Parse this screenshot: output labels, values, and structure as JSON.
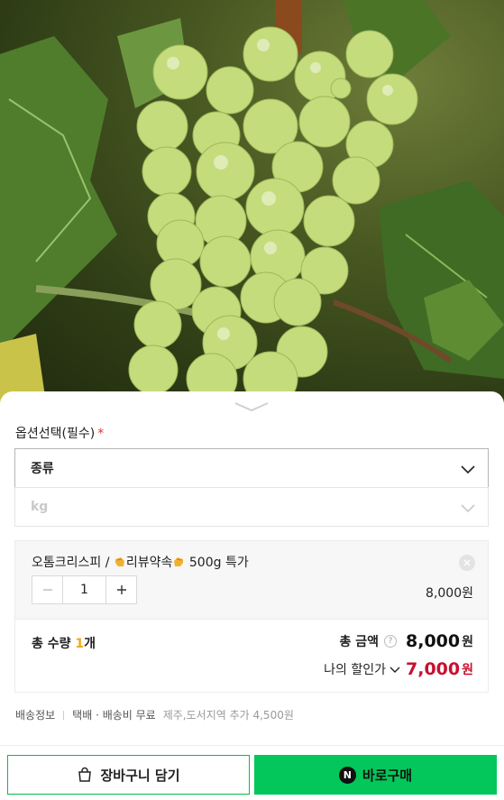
{
  "option": {
    "title": "옵션선택(필수)",
    "required_mark": "*",
    "select_type": "종류",
    "select_weight": "kg"
  },
  "item": {
    "name_prefix": "오톰크리스피 / ",
    "name_review": "리뷰약속",
    "name_suffix": " 500g 특가",
    "quantity": "1",
    "price": "8,000원"
  },
  "total": {
    "qty_label": "총 수량 ",
    "qty_value": "1",
    "qty_unit": "개",
    "amount_label": "총 금액",
    "help": "?",
    "amount_value": "8,000",
    "currency": "원",
    "discount_label": "나의 할인가",
    "discount_value": "7,000",
    "discount_currency": "원"
  },
  "shipping": {
    "label": "배송정보",
    "method": "택배 · 배송비 무료",
    "extra": "제주,도서지역 추가 4,500원"
  },
  "buttons": {
    "cart_label": "장바구니 담기",
    "buy_badge": "N",
    "buy_label": "바로구매"
  },
  "colors": {
    "accent_green": "#03c75a",
    "discount_red": "#c8102e",
    "qty_orange": "#f0a91a"
  }
}
